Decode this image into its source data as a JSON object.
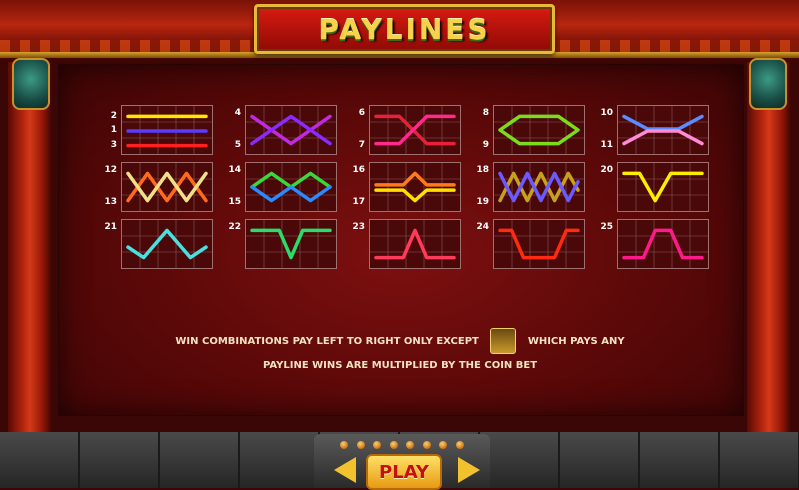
{
  "title": "PAYLINES",
  "paylines": [
    {
      "nums": [
        "2",
        "1",
        "3"
      ],
      "lines": [
        {
          "color": "#ffe600",
          "pts": [
            [
              0,
              1
            ],
            [
              4,
              1
            ]
          ]
        },
        {
          "color": "#5a3cff",
          "pts": [
            [
              0,
              2.4
            ],
            [
              4,
              2.4
            ]
          ]
        },
        {
          "color": "#ff2020",
          "pts": [
            [
              0,
              3.8
            ],
            [
              4,
              3.8
            ]
          ]
        }
      ]
    },
    {
      "nums": [
        "4",
        "5"
      ],
      "lines": [
        {
          "color": "#c02ae0",
          "pts": [
            [
              0,
              1
            ],
            [
              2,
              3.6
            ],
            [
              4,
              1
            ]
          ]
        },
        {
          "color": "#8a2aff",
          "pts": [
            [
              0,
              3.6
            ],
            [
              2,
              1
            ],
            [
              4,
              3.6
            ]
          ]
        }
      ]
    },
    {
      "nums": [
        "6",
        "7"
      ],
      "lines": [
        {
          "color": "#e8203a",
          "pts": [
            [
              0,
              1
            ],
            [
              1.2,
              1
            ],
            [
              2.6,
              3.6
            ],
            [
              4,
              3.6
            ]
          ]
        },
        {
          "color": "#ff2a8a",
          "pts": [
            [
              0,
              3.6
            ],
            [
              1.2,
              3.6
            ],
            [
              2.6,
              1
            ],
            [
              4,
              1
            ]
          ]
        }
      ]
    },
    {
      "nums": [
        "8",
        "9"
      ],
      "lines": [
        {
          "color": "#7adc1a",
          "pts": [
            [
              0,
              2.3
            ],
            [
              1,
              1
            ],
            [
              3,
              1
            ],
            [
              4,
              2.3
            ],
            [
              3,
              3.6
            ],
            [
              1,
              3.6
            ],
            [
              0,
              2.3
            ]
          ]
        }
      ]
    },
    {
      "nums": [
        "10",
        "11"
      ],
      "lines": [
        {
          "color": "#5a8cff",
          "pts": [
            [
              0,
              1
            ],
            [
              1.2,
              2.2
            ],
            [
              2.8,
              2.2
            ],
            [
              4,
              1
            ]
          ]
        },
        {
          "color": "#ff8ad8",
          "pts": [
            [
              0,
              3.6
            ],
            [
              1.2,
              2.4
            ],
            [
              2.8,
              2.4
            ],
            [
              4,
              3.6
            ]
          ]
        }
      ]
    },
    {
      "nums": [
        "12",
        "13"
      ],
      "lines": [
        {
          "color": "#ff6a1a",
          "pts": [
            [
              0,
              3.6
            ],
            [
              1,
              1
            ],
            [
              2,
              3.6
            ],
            [
              3,
              1
            ],
            [
              4,
              3.6
            ]
          ]
        },
        {
          "color": "#f0e08a",
          "pts": [
            [
              0,
              1
            ],
            [
              1,
              3.6
            ],
            [
              2,
              1
            ],
            [
              3,
              3.6
            ],
            [
              4,
              1
            ]
          ]
        }
      ]
    },
    {
      "nums": [
        "14",
        "15"
      ],
      "lines": [
        {
          "color": "#3ad83a",
          "pts": [
            [
              0,
              2.3
            ],
            [
              1,
              1
            ],
            [
              2,
              2.3
            ],
            [
              3,
              1
            ],
            [
              4,
              2.3
            ]
          ]
        },
        {
          "color": "#2a8aff",
          "pts": [
            [
              0,
              2.3
            ],
            [
              1,
              3.6
            ],
            [
              2,
              2.3
            ],
            [
              3,
              3.6
            ],
            [
              4,
              2.3
            ]
          ]
        }
      ]
    },
    {
      "nums": [
        "16",
        "17"
      ],
      "lines": [
        {
          "color": "#ff7a1a",
          "pts": [
            [
              0,
              2.1
            ],
            [
              1.4,
              2.1
            ],
            [
              2,
              1
            ],
            [
              2.6,
              2.1
            ],
            [
              4,
              2.1
            ]
          ]
        },
        {
          "color": "#ffe000",
          "pts": [
            [
              0,
              2.6
            ],
            [
              1.4,
              2.6
            ],
            [
              2,
              3.6
            ],
            [
              2.6,
              2.6
            ],
            [
              4,
              2.6
            ]
          ]
        }
      ]
    },
    {
      "nums": [
        "18",
        "19"
      ],
      "lines": [
        {
          "color": "#c8a020",
          "pts": [
            [
              0,
              3.6
            ],
            [
              0.7,
              1
            ],
            [
              1.4,
              3.6
            ],
            [
              2.1,
              1
            ],
            [
              2.8,
              3.6
            ],
            [
              3.5,
              1
            ],
            [
              4,
              2.6
            ]
          ]
        },
        {
          "color": "#6a5aff",
          "pts": [
            [
              0,
              1
            ],
            [
              0.7,
              3.6
            ],
            [
              1.4,
              1
            ],
            [
              2.1,
              3.6
            ],
            [
              2.8,
              1
            ],
            [
              3.5,
              3.6
            ],
            [
              4,
              1.8
            ]
          ]
        }
      ]
    },
    {
      "nums": [
        "20"
      ],
      "lines": [
        {
          "color": "#ffee00",
          "pts": [
            [
              0,
              1
            ],
            [
              0.8,
              1
            ],
            [
              1.6,
              3.6
            ],
            [
              2.4,
              1
            ],
            [
              3.2,
              1
            ],
            [
              4,
              1
            ]
          ]
        }
      ]
    },
    {
      "nums": [
        "21"
      ],
      "lines": [
        {
          "color": "#4ae0e0",
          "pts": [
            [
              0,
              2.6
            ],
            [
              0.8,
              3.6
            ],
            [
              2,
              1
            ],
            [
              3.2,
              3.6
            ],
            [
              4,
              2.6
            ]
          ]
        }
      ]
    },
    {
      "nums": [
        "22"
      ],
      "lines": [
        {
          "color": "#2adc6a",
          "pts": [
            [
              0,
              1
            ],
            [
              1.4,
              1
            ],
            [
              2,
              3.6
            ],
            [
              2.6,
              1
            ],
            [
              4,
              1
            ]
          ]
        }
      ]
    },
    {
      "nums": [
        "23"
      ],
      "lines": [
        {
          "color": "#ff3a5a",
          "pts": [
            [
              0,
              3.6
            ],
            [
              1.4,
              3.6
            ],
            [
              2,
              1
            ],
            [
              2.6,
              3.6
            ],
            [
              4,
              3.6
            ]
          ]
        }
      ]
    },
    {
      "nums": [
        "24"
      ],
      "lines": [
        {
          "color": "#ff2a10",
          "pts": [
            [
              0,
              1
            ],
            [
              0.6,
              1
            ],
            [
              1.2,
              3.6
            ],
            [
              2.8,
              3.6
            ],
            [
              3.4,
              1
            ],
            [
              4,
              1
            ]
          ]
        }
      ]
    },
    {
      "nums": [
        "25"
      ],
      "lines": [
        {
          "color": "#ff1a8a",
          "pts": [
            [
              0,
              3.6
            ],
            [
              1,
              3.6
            ],
            [
              1.6,
              1
            ],
            [
              2.4,
              1
            ],
            [
              3,
              3.6
            ],
            [
              4,
              3.6
            ]
          ]
        }
      ]
    }
  ],
  "info": {
    "line1_before": "WIN COMBINATIONS PAY LEFT TO RIGHT ONLY EXCEPT",
    "line1_after": "WHICH PAYS ANY",
    "line2": "PAYLINE WINS ARE MULTIPLIED BY THE COIN BET"
  },
  "nav": {
    "play_label": "PLAY",
    "page_dots": 8
  }
}
